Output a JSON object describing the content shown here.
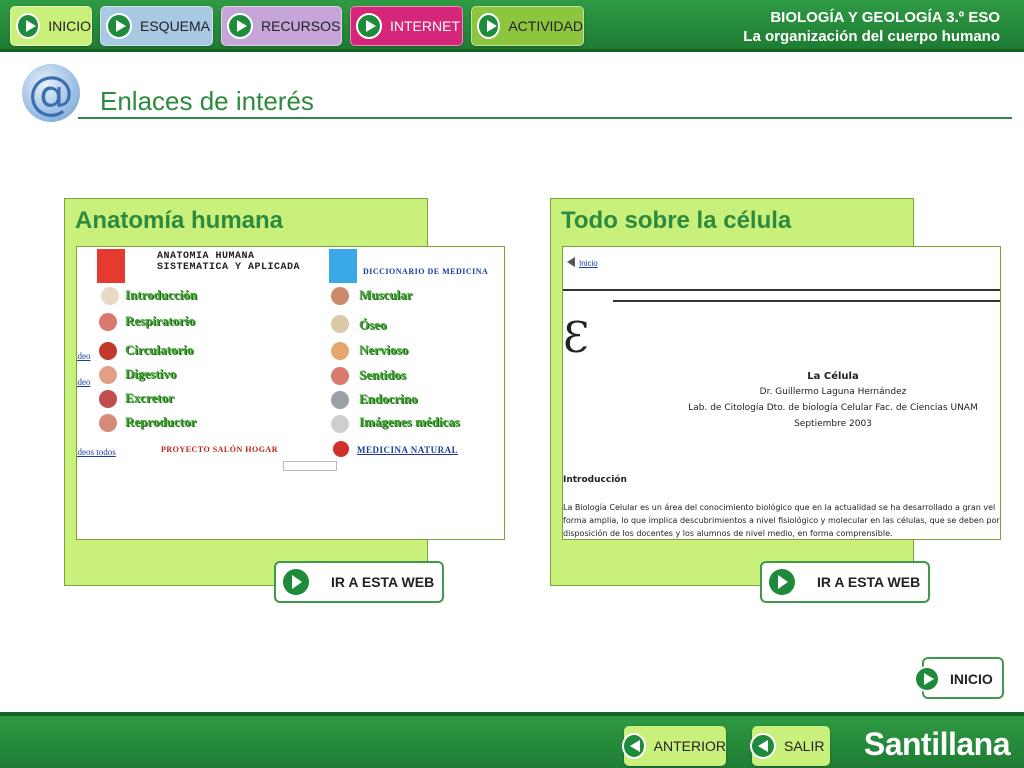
{
  "nav": {
    "items": [
      {
        "label": "INICIO",
        "color": "#c9f07a"
      },
      {
        "label": "ESQUEMA",
        "color": "#a7c9e2"
      },
      {
        "label": "RECURSOS",
        "color": "#c6a5d8"
      },
      {
        "label": "INTERNET",
        "color": "#d6267a"
      },
      {
        "label": "ACTIVIDAD",
        "color": "#8cc63f"
      }
    ]
  },
  "course": {
    "subject": "BIOLOGÍA Y GEOLOGÍA 3.º ESO",
    "unit": "La organización del cuerpo humano"
  },
  "section": {
    "title": "Enlaces de interés"
  },
  "cards": [
    {
      "title": "Anatomía humana",
      "button": "IR A ESTA WEB",
      "preview": {
        "header_line1": "ANATOMIA HUMANA",
        "header_line2": "SISTEMATICA Y APLICADA",
        "dictionary": "DICCIONARIO DE MEDICINA",
        "left_links": [
          "Introducción",
          "Respiratorio",
          "Circulatorio",
          "Digestivo",
          "Excretor",
          "Reproductor"
        ],
        "right_links": [
          "Muscular",
          "Óseo",
          "Nervioso",
          "Sentidos",
          "Endocrino",
          "Imágenes médicas"
        ],
        "side_links": [
          "ídeo",
          "ídeo",
          "ídeos todos"
        ],
        "project": "PROYECTO SALÓN HOGAR",
        "natural": "MEDICINA NATURAL"
      }
    },
    {
      "title": "Todo sobre la célula",
      "button": "IR A ESTA WEB",
      "preview": {
        "back_link": "Inicio",
        "heading": "La Célula",
        "author": "Dr. Guillermo Laguna Hernández",
        "affiliation": "Lab. de Citología Dto. de biología Celular Fac. de Ciencias UNAM",
        "date": "Septiembre 2003",
        "intro_heading": "Introducción",
        "paragraph": [
          "La Biología Celular es un área del conocimiento biológico que en la actualidad se ha desarrollado a gran vel",
          "forma amplia, lo que implica descubrimientos a nivel fisiológico y molecular en las células, que se deben por",
          "disposición de los docentes y los alumnos de nivel medio, en forma comprensible."
        ]
      }
    }
  ],
  "home_button": "INICIO",
  "footer": {
    "prev": "ANTERIOR",
    "exit": "SALIR",
    "brand": "Santillana"
  }
}
